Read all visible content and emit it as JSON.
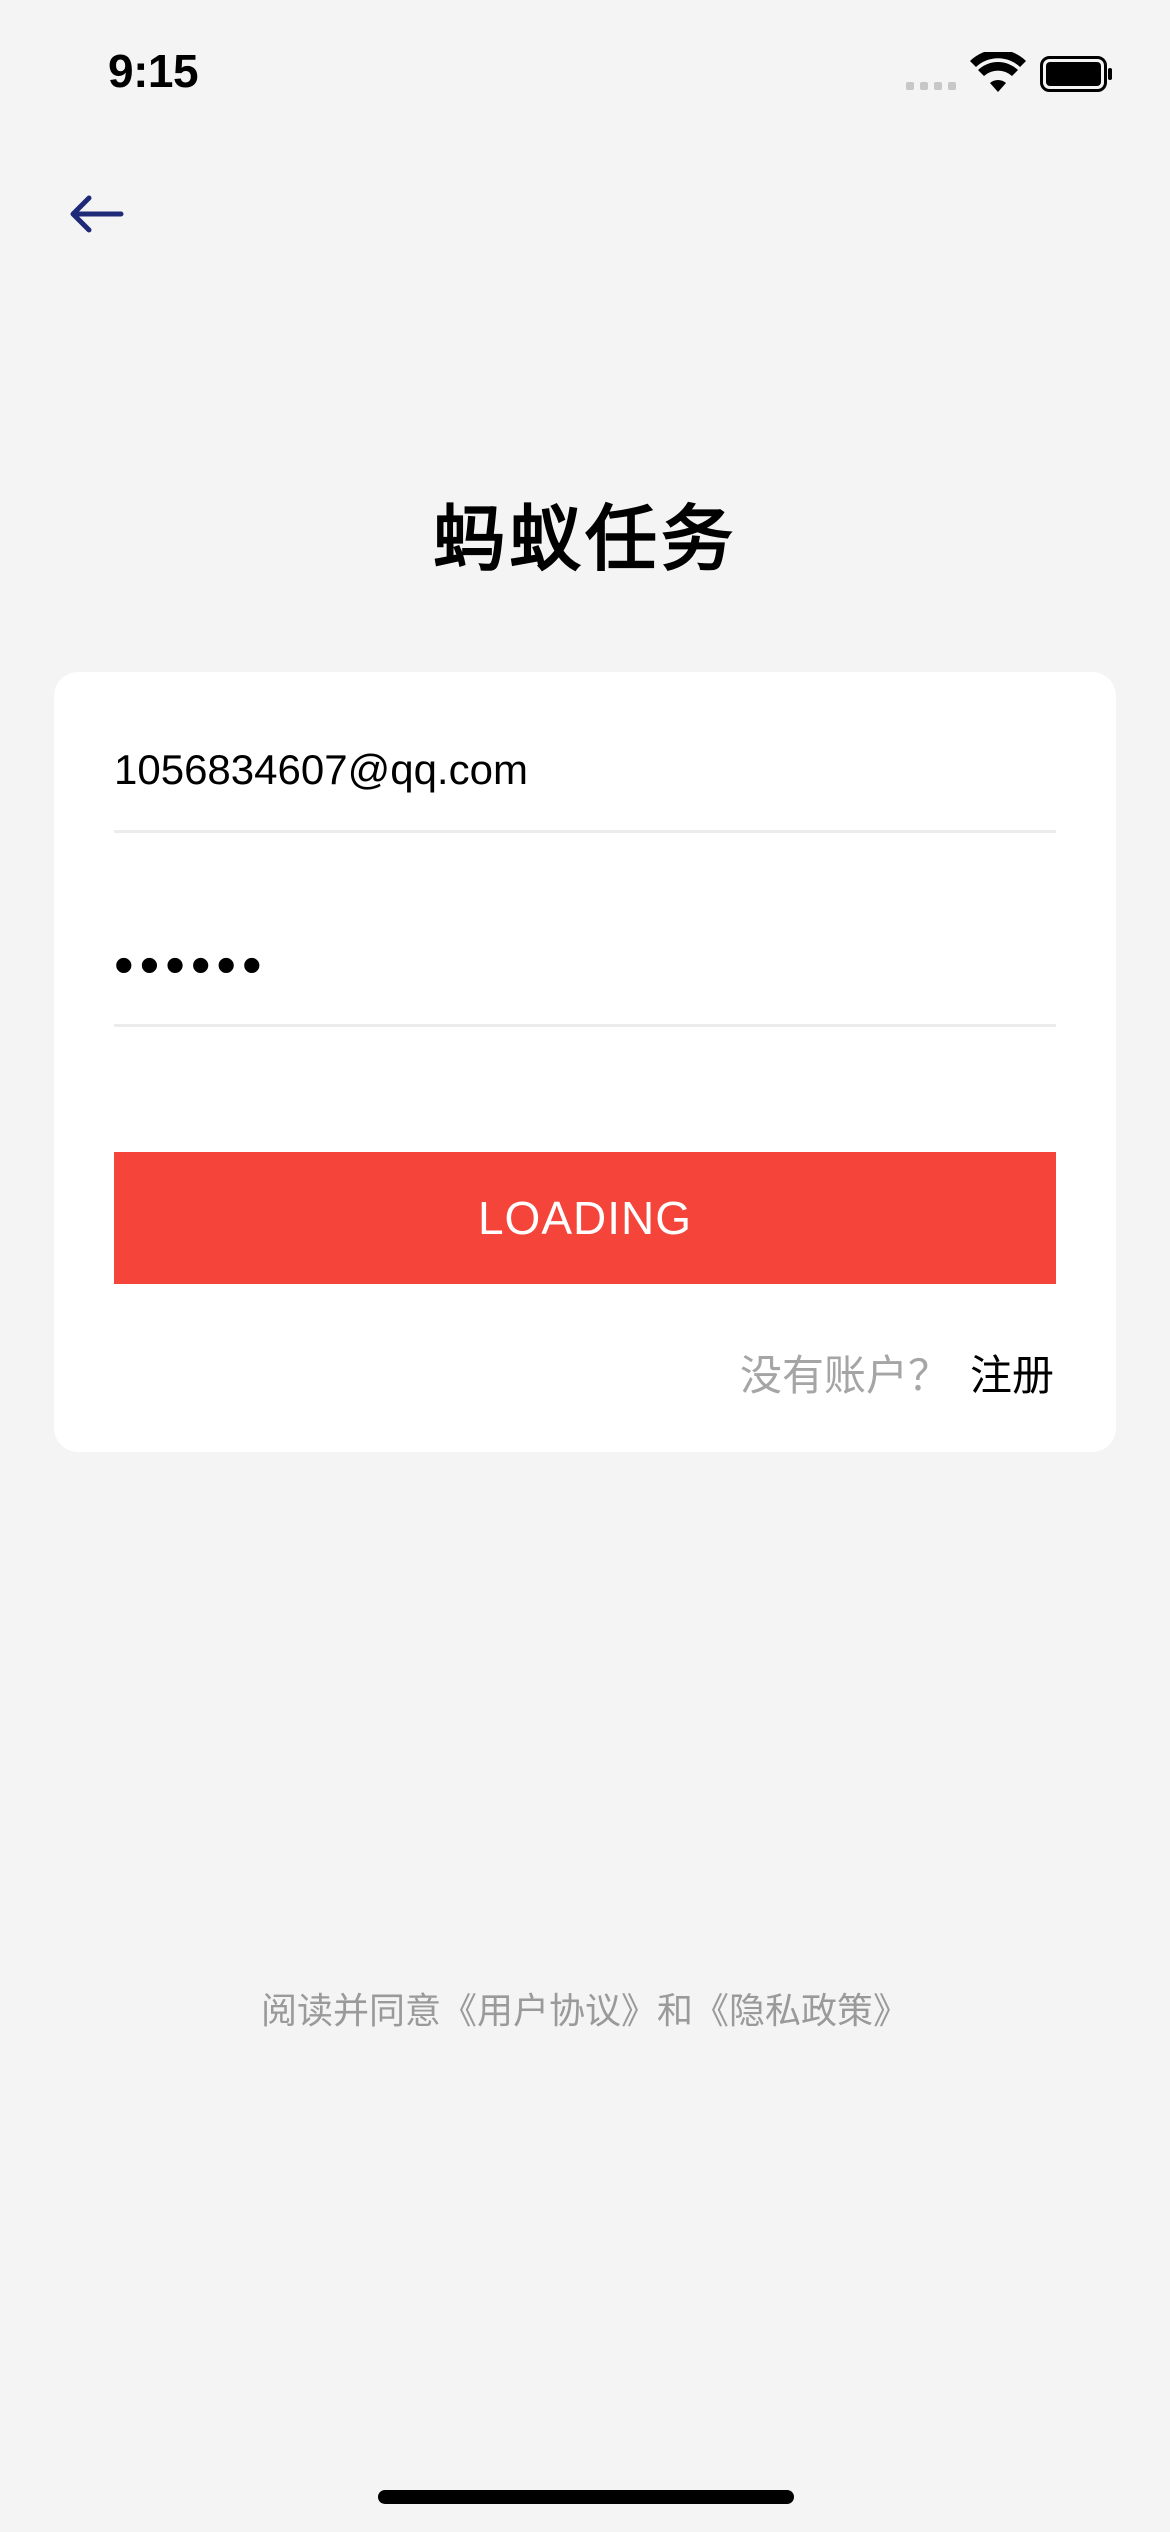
{
  "status_bar": {
    "time": "9:15",
    "icons": [
      "cellular-signal-icon",
      "wifi-icon",
      "battery-icon"
    ]
  },
  "nav": {
    "back_icon": "arrow-left-icon"
  },
  "title": "蚂蚁任务",
  "form": {
    "email_value": "1056834607@qq.com",
    "password_value": "••••••",
    "submit_label": "LOADING",
    "register_prompt": "没有账户？",
    "register_link": "注册"
  },
  "agreement": "阅读并同意《用户协议》和《隐私政策》",
  "colors": {
    "background": "#f4f4f4",
    "card": "#ffffff",
    "primary_button": "#f5453b",
    "back_arrow": "#1e2a78",
    "muted_text": "#a5a5a5"
  }
}
